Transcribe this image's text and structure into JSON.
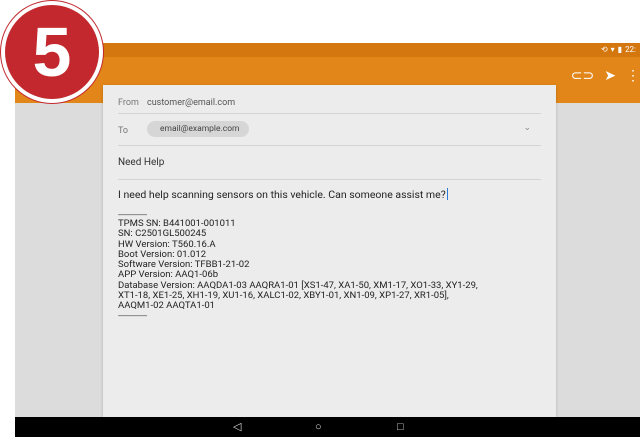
{
  "step_badge": "5",
  "status_bar": {
    "icons": [
      "sync-icon",
      "wifi-icon",
      "battery-icon"
    ],
    "time": "22:"
  },
  "toolbar": {
    "icons": [
      "attach-icon",
      "send-icon",
      "more-icon"
    ]
  },
  "compose": {
    "from_label": "From",
    "from_value": "customer@email.com",
    "to_label": "To",
    "to_value": "email@example.com",
    "subject": "Need Help",
    "body_message": "I need help scanning sensors on this vehicle. Can someone assist me?",
    "separator": "--------------------",
    "info_lines": [
      "TPMS SN: B441001-001011",
      "SN: C2501GL500245",
      "HW Version: T560.16.A",
      "Boot Version: 01.012",
      "Software Version: TFBB1-21-02",
      "APP Version: AAQ1-06b",
      "Database Version: AAQDA1-03 AAQRA1-01 [XS1-47, XA1-50, XM1-17, XO1-33, XY1-29,",
      "XT1-18, XE1-25, XH1-19, XU1-16, XALC1-02, XBY1-01, XN1-09, XP1-27, XR1-05],",
      "AAQM1-02 AAQTA1-01"
    ],
    "separator_end": "--------------------"
  },
  "nav_bar": {
    "back": "◁",
    "home": "○",
    "recents": "□"
  },
  "colors": {
    "app_bar": "#e28619",
    "status_bar": "#d4770f",
    "badge": "#c2282d"
  }
}
